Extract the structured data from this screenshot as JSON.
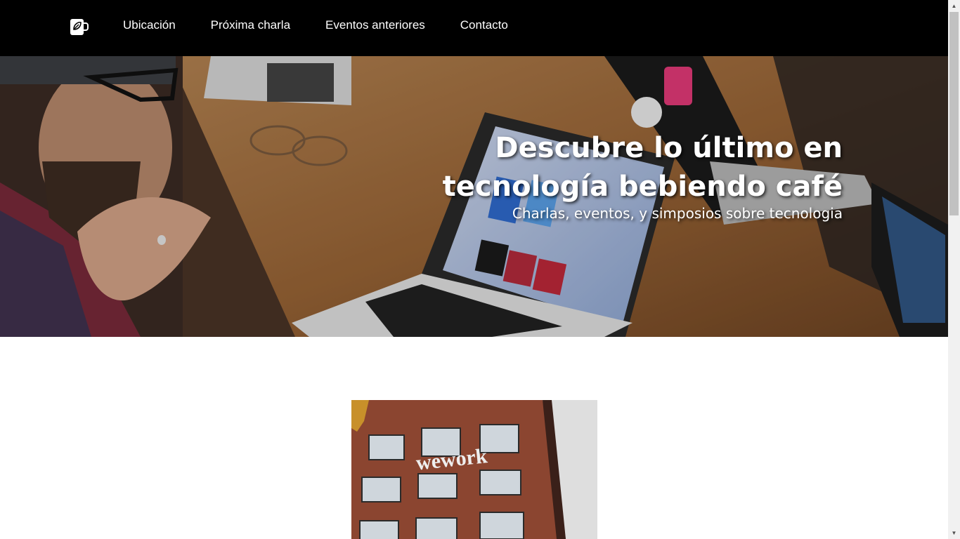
{
  "nav": {
    "logo_icon": "coffee-cup-leaf-icon",
    "links": [
      "Ubicación",
      "Próxima charla",
      "Eventos anteriores",
      "Contacto"
    ]
  },
  "hero": {
    "title": "Descubre lo último en tecnología bebiendo café",
    "subtitle": "Charlas, eventos, y simposios sobre tecnologia"
  },
  "building": {
    "sign": "wework"
  },
  "colors": {
    "navbar": "#000000",
    "hero_text": "#ffffff"
  }
}
